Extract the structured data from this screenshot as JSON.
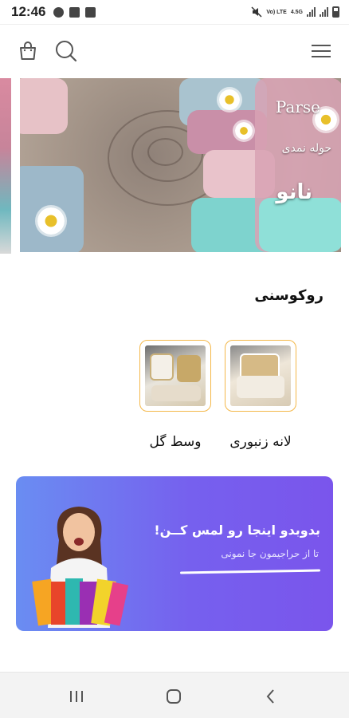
{
  "status_bar": {
    "time": "12:46",
    "network_label": "Vo) LTE",
    "network_speed": "4.5G",
    "battery_level": 0.6
  },
  "header": {
    "icons": [
      "bag-icon",
      "search-icon",
      "menu-icon"
    ]
  },
  "banner": {
    "brand": "Parse",
    "subtitle": "حوله نمدی",
    "product_name": "نانو"
  },
  "categories_section": {
    "title": "روکوسنی",
    "items": [
      {
        "label": "لانه زنبوری"
      },
      {
        "label": "وسط گل"
      }
    ]
  },
  "promo": {
    "title": "بدوبدو اینجا رو لمس کــن!",
    "subtitle": "تا از حراجیمون جا نمونی"
  },
  "colors": {
    "accent_border": "#f4b84a",
    "promo_start": "#6a8df2",
    "promo_end": "#7a55ec"
  },
  "nav_bar": {
    "icons": [
      "recents-icon",
      "home-icon",
      "back-icon"
    ]
  }
}
